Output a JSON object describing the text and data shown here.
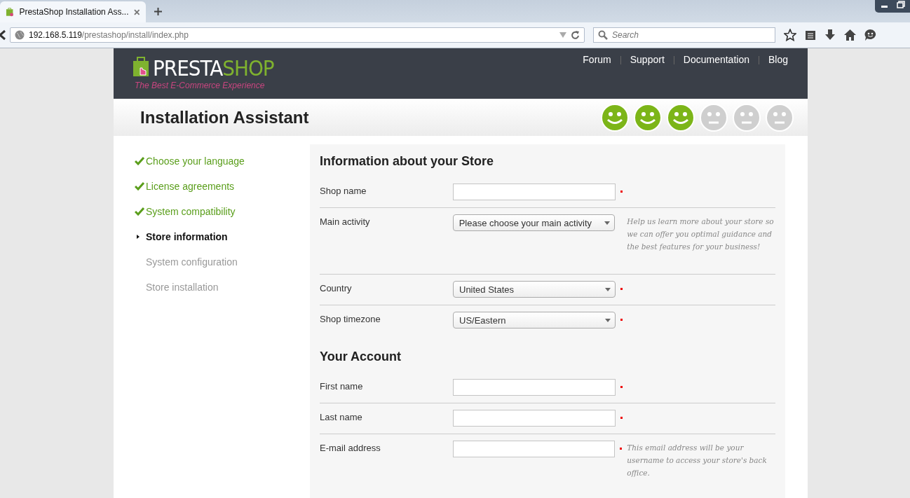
{
  "browser": {
    "tab_title": "PrestaShop Installation Ass...",
    "url_host": "192.168.5.119",
    "url_path": "/prestashop/install/index.php",
    "search_placeholder": "Search"
  },
  "header": {
    "logo_main": "PRESTA",
    "logo_accent": "SHOP",
    "tagline": "The Best E-Commerce Experience",
    "links": [
      "Forum",
      "Support",
      "Documentation",
      "Blog"
    ]
  },
  "title": "Installation Assistant",
  "progress": [
    {
      "done": true
    },
    {
      "done": true
    },
    {
      "done": true
    },
    {
      "done": false
    },
    {
      "done": false
    },
    {
      "done": false
    }
  ],
  "steps": [
    {
      "label": "Choose your language",
      "done": true,
      "selected": false
    },
    {
      "label": "License agreements",
      "done": true,
      "selected": false
    },
    {
      "label": "System compatibility",
      "done": true,
      "selected": false
    },
    {
      "label": "Store information",
      "done": false,
      "selected": true
    },
    {
      "label": "System configuration",
      "done": false,
      "selected": false
    },
    {
      "label": "Store installation",
      "done": false,
      "selected": false
    }
  ],
  "sections": [
    {
      "title": "Information about your Store",
      "fields": [
        {
          "label": "Shop name",
          "kind": "text",
          "required": true
        },
        {
          "label": "Main activity",
          "kind": "select",
          "value": "Please choose your main activity",
          "required": false,
          "hint": "Help us learn more about your store so we can offer you optimal guidance and the best features for your business!"
        },
        {
          "label": "Country",
          "kind": "select",
          "value": "United States",
          "required": true
        },
        {
          "label": "Shop timezone",
          "kind": "select",
          "value": "US/Eastern",
          "required": true
        }
      ]
    },
    {
      "title": "Your Account",
      "fields": [
        {
          "label": "First name",
          "kind": "text",
          "required": true
        },
        {
          "label": "Last name",
          "kind": "text",
          "required": true
        },
        {
          "label": "E-mail address",
          "kind": "text",
          "required": true,
          "hint": "This email address will be your username to access your store's back office."
        }
      ]
    }
  ]
}
